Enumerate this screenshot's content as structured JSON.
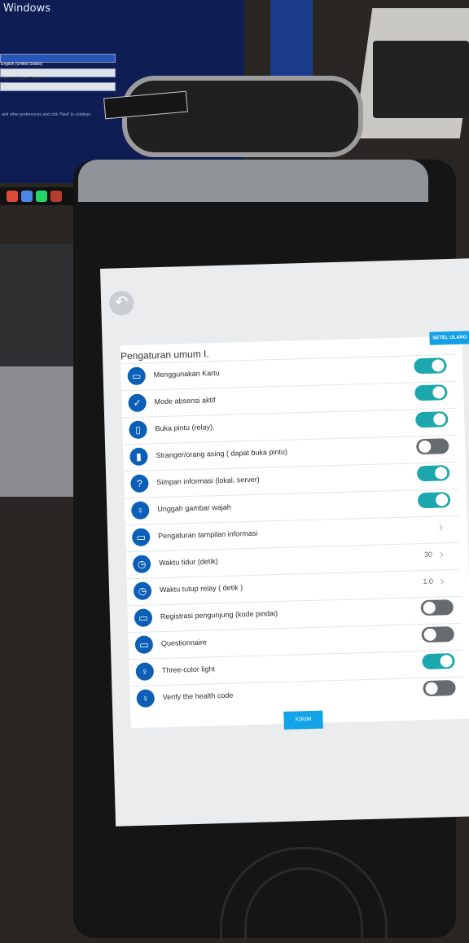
{
  "background": {
    "monitor_title": "Windows",
    "monitor_fields": [
      "English (United States)",
      "English (United States)",
      ""
    ],
    "monitor_caption": "and other preferences and click 'Next' to continue."
  },
  "settings": {
    "title": "Pengaturan umum I.",
    "reset_label": "SETEL ULANG",
    "submit_label": "KIRIM",
    "rows": [
      {
        "label": "Menggunakan Kartu",
        "icon": "card-icon",
        "glyph": "▭",
        "type": "toggle",
        "on": true
      },
      {
        "label": "Mode absensi aktif",
        "icon": "check-icon",
        "glyph": "✓",
        "type": "toggle",
        "on": true
      },
      {
        "label": "Buka pintu (relay).",
        "icon": "door-icon",
        "glyph": "▯",
        "type": "toggle",
        "on": true
      },
      {
        "label": "Stranger/orang asing ( dapat buka pintu)",
        "icon": "stranger-icon",
        "glyph": "▮",
        "type": "toggle",
        "on": false
      },
      {
        "label": "Simpan informasi (lokal, server)",
        "icon": "question-icon",
        "glyph": "?",
        "type": "toggle",
        "on": true
      },
      {
        "label": "Unggah gambar wajah",
        "icon": "bulb-icon",
        "glyph": "♀",
        "type": "toggle",
        "on": true
      },
      {
        "label": "Pengaturan tampilan informasi",
        "icon": "display-icon",
        "glyph": "▭",
        "type": "link",
        "value": ""
      },
      {
        "label": "Waktu tidur (detik)",
        "icon": "clock-icon",
        "glyph": "◷",
        "type": "link",
        "value": "30"
      },
      {
        "label": "Waktu tutup relay ( detik )",
        "icon": "clock-icon",
        "glyph": "◷",
        "type": "link",
        "value": "1.0"
      },
      {
        "label": "Registrasi pengunjung (kode pindai)",
        "icon": "card-icon",
        "glyph": "▭",
        "type": "toggle",
        "on": false
      },
      {
        "label": "Questionnaire",
        "icon": "card-icon",
        "glyph": "▭",
        "type": "toggle",
        "on": false
      },
      {
        "label": "Three-color light",
        "icon": "bulb-icon",
        "glyph": "♀",
        "type": "toggle",
        "on": true
      },
      {
        "label": "Verify the health code",
        "icon": "bulb-icon",
        "glyph": "♀",
        "type": "toggle",
        "on": false
      }
    ]
  },
  "colors": {
    "accent": "#1ba7ad",
    "icon_blue": "#0b5fb6",
    "button_blue": "#13a3e8"
  }
}
